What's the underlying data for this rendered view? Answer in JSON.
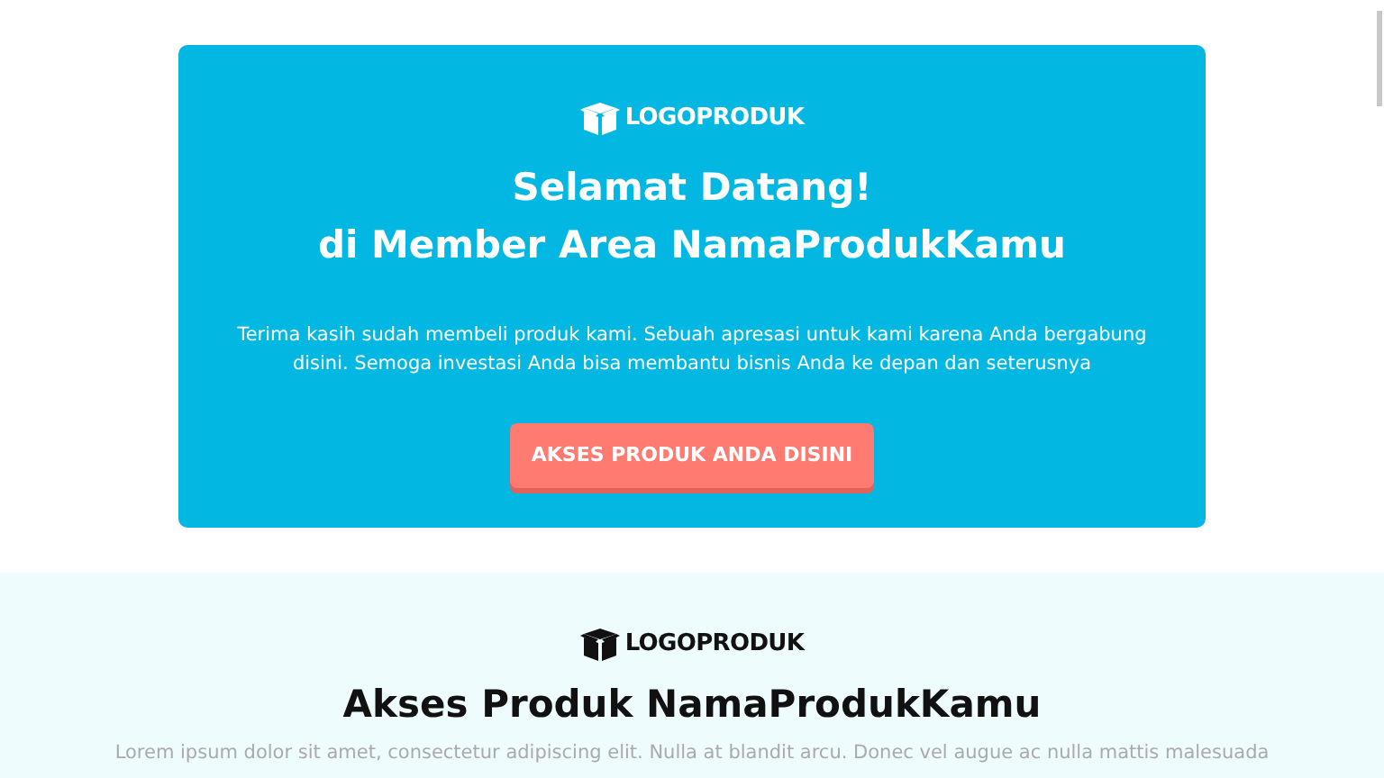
{
  "hero": {
    "logo": "LOGOPRODUK",
    "title_line_1": "Selamat Datang!",
    "title_line_2": "di Member Area NamaProdukKamu",
    "message": "Terima kasih sudah membeli produk kami. Sebuah apresasi untuk kami karena Anda bergabung disini. Semoga investasi Anda bisa membantu bisnis Anda ke depan dan seterusnya",
    "button": "AKSES PRODUK ANDA DISINI"
  },
  "access_section": {
    "logo": "LOGOPRODUK",
    "heading": "Akses Produk NamaProdukKamu",
    "intro": "Lorem ipsum dolor sit amet, consectetur adipiscing elit. Nulla at blandit arcu. Donec vel augue ac nulla mattis malesuada"
  }
}
